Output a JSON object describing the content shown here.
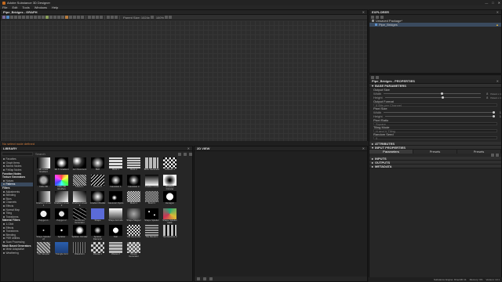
{
  "app": {
    "title": "Adobe Substance 3D Designer"
  },
  "window_controls": {
    "minimize": "—",
    "maximize": "□",
    "close": "✕"
  },
  "menubar": [
    "File",
    "Edit",
    "Tools",
    "Windows",
    "Help"
  ],
  "graph": {
    "header": "Pipe_Bridges - GRAPH",
    "close": "✕",
    "parent_size_label": "Parent Size: 1024x",
    "zoom_label": "100%"
  },
  "status_strip": {
    "message": "No select node defined"
  },
  "explorer": {
    "header": "EXPLORER",
    "close": "✕",
    "rows": [
      {
        "label": "Unsaved Package*",
        "warning": ""
      },
      {
        "label": "Pipe_Bridges",
        "warning": "▲"
      }
    ]
  },
  "properties": {
    "header": "Pipe_Bridges - PROPERTIES",
    "close": "✕",
    "sections": {
      "base": "BASE PARAMETERS",
      "attributes": "ATTRIBUTES",
      "input": "INPUT PROPERTIES",
      "inputs": "INPUTS",
      "outputs": "OUTPUTS",
      "metadata": "METADATA"
    },
    "output_size": {
      "label": "Output Size",
      "width_label": "Width",
      "height_label": "Height",
      "width_value": "8",
      "height_value": "8",
      "width_suffix": "Parent x 1",
      "height_suffix": "Parent x 1",
      "width_level": 0.6,
      "height_level": 0.6
    },
    "output_format": {
      "label": "Output Format",
      "value": "8 Bits per Channel"
    },
    "pixel_size": {
      "label": "Pixel Size",
      "width_label": "Width",
      "height_label": "Height",
      "width_value": "1",
      "height_value": "1",
      "width_level": 1.0,
      "height_level": 1.0
    },
    "pixel_ratio": {
      "label": "Pixel Ratio",
      "value": "Square"
    },
    "tiling_mode": {
      "label": "Tiling Mode",
      "value": "H and V Tiling"
    },
    "random_seed": {
      "label": "Random Seed",
      "value": "0"
    },
    "input_tabs": [
      "Parameters",
      "Presets",
      "Presets"
    ]
  },
  "library": {
    "header": "LIBRARY",
    "close": "✕",
    "search_placeholder": "Search",
    "tree": [
      {
        "label": "Favorites",
        "type": "item"
      },
      {
        "label": "Graph Items",
        "type": "item"
      },
      {
        "label": "Atomic Nodes",
        "type": "item"
      },
      {
        "label": "FxMap Nodes",
        "type": "item"
      },
      {
        "label": "Function Nodes",
        "type": "cat"
      },
      {
        "label": "Texture Generators",
        "type": "cat"
      },
      {
        "label": "Noises",
        "type": "item"
      },
      {
        "label": "Patterns",
        "type": "sel"
      },
      {
        "label": "Filters",
        "type": "cat"
      },
      {
        "label": "Adjustments",
        "type": "item"
      },
      {
        "label": "Blending",
        "type": "item"
      },
      {
        "label": "Blurs",
        "type": "item"
      },
      {
        "label": "Channels",
        "type": "item"
      },
      {
        "label": "Effects",
        "type": "item"
      },
      {
        "label": "Normal Map",
        "type": "item"
      },
      {
        "label": "Tiling",
        "type": "item"
      },
      {
        "label": "Transforms",
        "type": "item"
      },
      {
        "label": "Material Filters",
        "type": "cat"
      },
      {
        "label": "1-Click",
        "type": "item"
      },
      {
        "label": "Effects",
        "type": "item"
      },
      {
        "label": "Transforms",
        "type": "item"
      },
      {
        "label": "Blending",
        "type": "item"
      },
      {
        "label": "PBR Utilities",
        "type": "item"
      },
      {
        "label": "Scan Processing",
        "type": "item"
      },
      {
        "label": "Mesh Based Generators",
        "type": "cat"
      },
      {
        "label": "Mesh Adaptative",
        "type": "item"
      },
      {
        "label": "Weathering",
        "type": "item"
      }
    ],
    "thumbs": [
      "3D Linear Gradient",
      "3D Ti Gradient",
      "Arc Pavement",
      "Bell",
      "Brick 1",
      "Brick 2",
      "Brick Generator",
      "Checker 1",
      "Cube 3D",
      "Cube 3D Gbuffers",
      "Fibers 1",
      "Fibers 2",
      "Gaussian 1",
      "Gaussian 2",
      "Gradient Axial",
      "Gradient Circular",
      "Gradient Linear 1",
      "Gradient Linear 2",
      "Gradient Linear 3",
      "Gradient Radial",
      "Gaussian Spots",
      "Mesh 1",
      "Mesh 2",
      "Hexagon",
      "Polygon 1",
      "Polygon 2",
      "Scratches Generator",
      "Shape",
      "Shape Extrude",
      "Shape Mapper",
      "Shape Splatter",
      "Shape Splatter Data",
      "Shape Splatter v2",
      "Splatter",
      "Splatter Circular",
      "Splatter Diamond",
      "Star",
      "Tile Generator",
      "Tile Random",
      "Tile Random 2",
      "Tile Sampler",
      "Triangle Grid",
      "Waveform",
      "Weave 1",
      "Weave 2",
      "Weave Generator"
    ]
  },
  "view2d": {
    "header": "2D VIEW",
    "close": "✕",
    "status": [
      "",
      "",
      ""
    ]
  },
  "bottom_status": {
    "engine": "Substance Engine: Direct3D 11",
    "memory": "Memory: 0%",
    "version": "Version: 13.1"
  }
}
